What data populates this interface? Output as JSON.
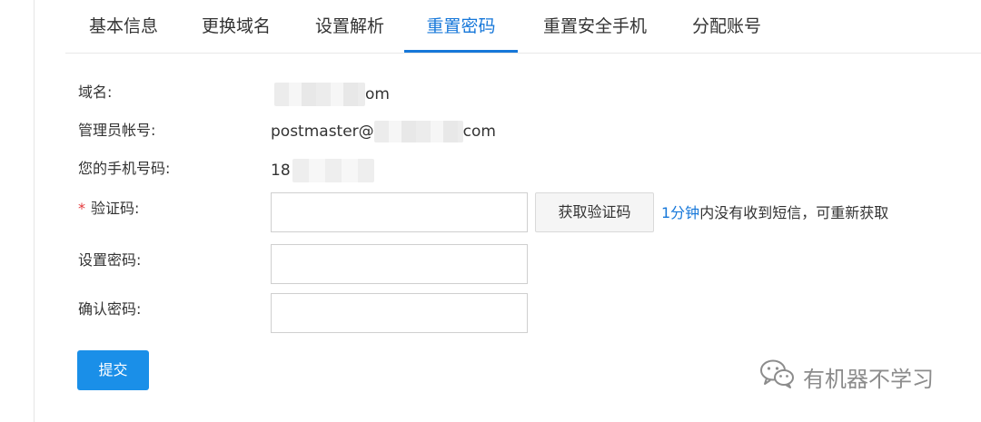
{
  "tabs": [
    {
      "label": "基本信息",
      "active": false
    },
    {
      "label": "更换域名",
      "active": false
    },
    {
      "label": "设置解析",
      "active": false
    },
    {
      "label": "重置密码",
      "active": true
    },
    {
      "label": "重置安全手机",
      "active": false
    },
    {
      "label": "分配账号",
      "active": false
    }
  ],
  "form": {
    "domain": {
      "label": "域名:",
      "value_visible": "om"
    },
    "admin_account": {
      "label": "管理员帐号:",
      "value_prefix": "postmaster@",
      "value_suffix": "com"
    },
    "phone": {
      "label": "您的手机号码:",
      "value_visible": "18"
    },
    "verify_code": {
      "required_mark": "*",
      "label": "验证码:",
      "value": "",
      "placeholder": ""
    },
    "get_code_button": "获取验证码",
    "hint": {
      "count": "1分钟",
      "text": "内没有收到短信，可重新获取"
    },
    "set_password": {
      "label": "设置密码:",
      "value": "",
      "placeholder": ""
    },
    "confirm_password": {
      "label": "确认密码:",
      "value": "",
      "placeholder": ""
    },
    "submit_button": "提交"
  },
  "watermark": {
    "text": "有机器不学习",
    "icon": "wechat-icon"
  },
  "colors": {
    "accent": "#1677d9",
    "submit": "#1a8fe8",
    "required": "#e4393c"
  }
}
